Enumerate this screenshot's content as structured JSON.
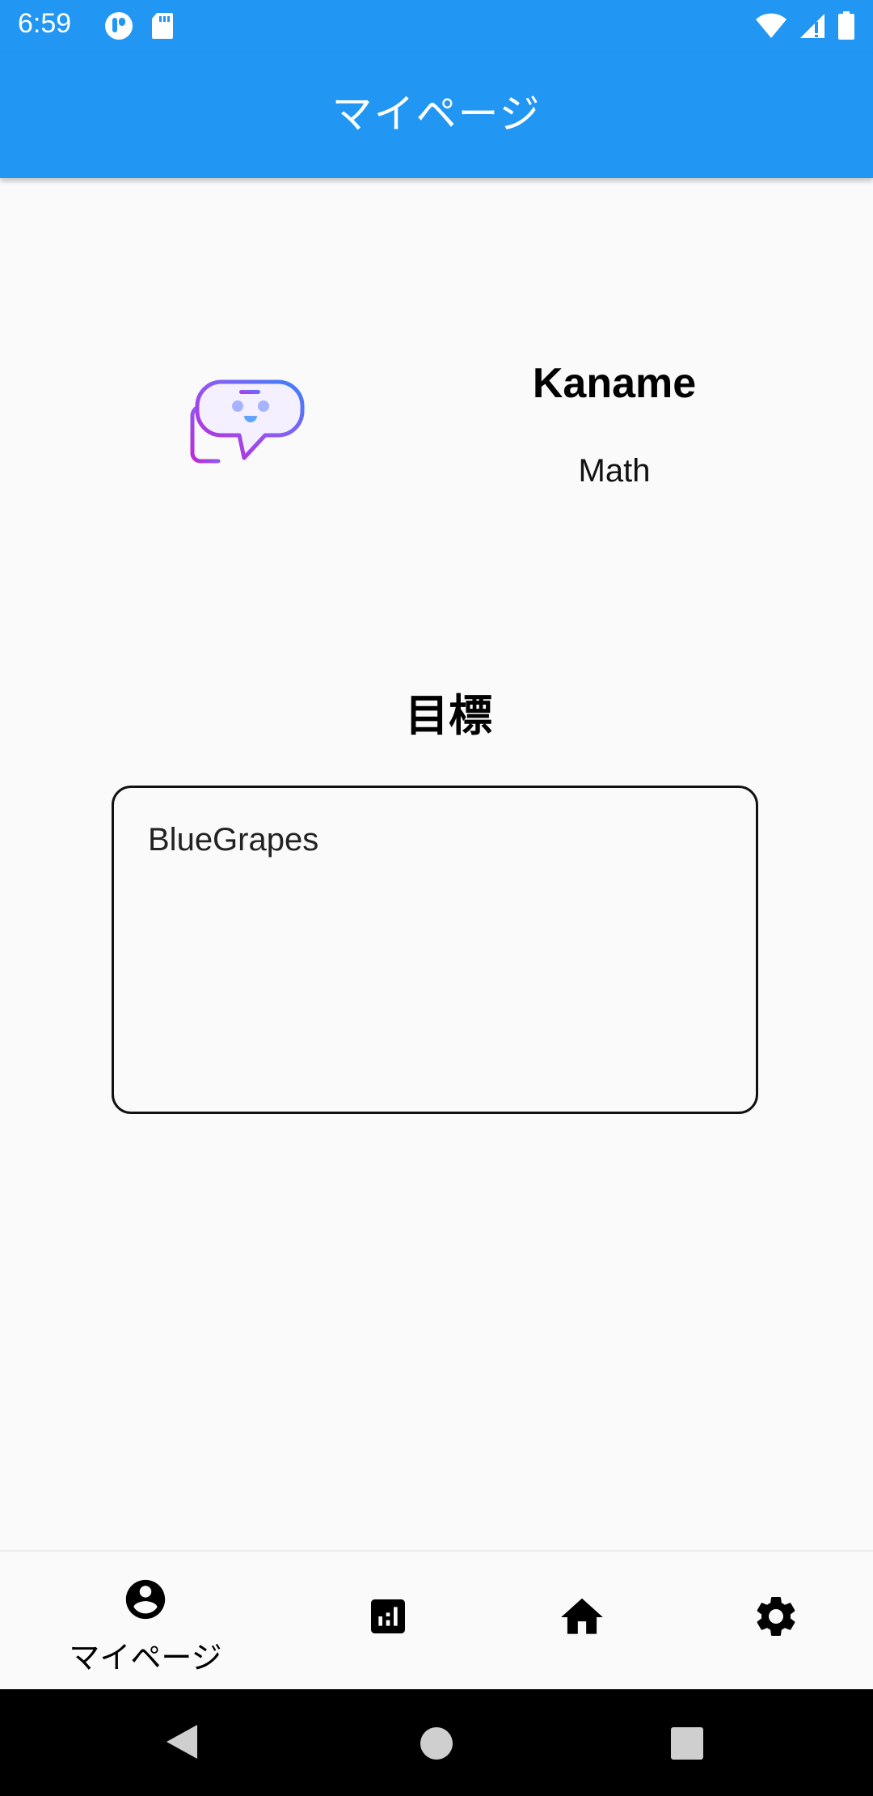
{
  "status_bar": {
    "time": "6:59",
    "icons": [
      "app-notification-icon",
      "sd-card-icon",
      "wifi-icon",
      "signal-icon",
      "battery-icon"
    ],
    "color": "#2196f3"
  },
  "app_bar": {
    "title": "マイページ",
    "color": "#2196f3"
  },
  "profile": {
    "avatar_icon": "chat-bubble-face-icon",
    "name": "Kaname",
    "subject": "Math"
  },
  "goal": {
    "heading": "目標",
    "text": "BlueGrapes"
  },
  "bottom_nav": {
    "items": [
      {
        "icon": "account-circle-icon",
        "label": "マイページ",
        "active": true
      },
      {
        "icon": "bar-chart-icon",
        "label": "",
        "active": false
      },
      {
        "icon": "home-icon",
        "label": "",
        "active": false
      },
      {
        "icon": "settings-gear-icon",
        "label": "",
        "active": false
      }
    ]
  },
  "system_nav": {
    "buttons": [
      "back-icon",
      "home-circle-icon",
      "recents-icon"
    ]
  }
}
